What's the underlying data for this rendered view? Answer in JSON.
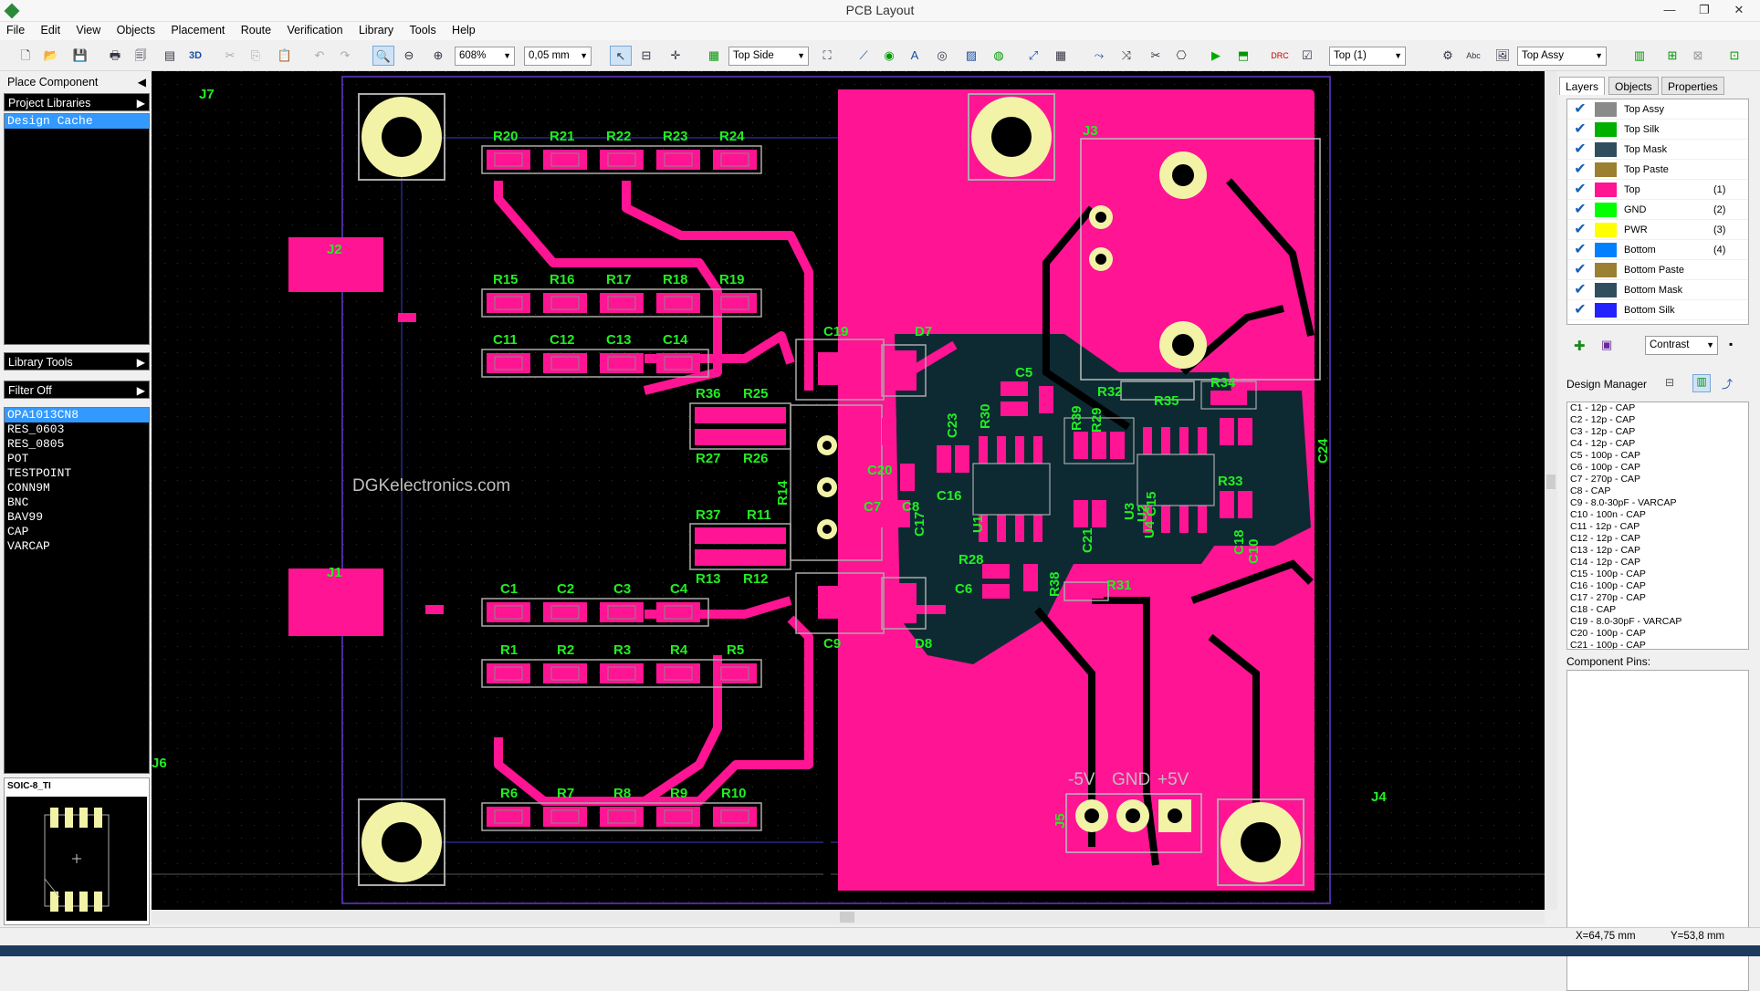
{
  "window": {
    "title": "PCB Layout",
    "minimize": "—",
    "maximize": "❐",
    "close": "✕"
  },
  "menu": [
    "File",
    "Edit",
    "View",
    "Objects",
    "Placement",
    "Route",
    "Verification",
    "Library",
    "Tools",
    "Help"
  ],
  "toolbar": {
    "zoom": "608%",
    "grid": "0,05 mm",
    "side": "Top Side",
    "layer": "Top (1)",
    "assy": "Top Assy"
  },
  "left_panel": {
    "place_component": "Place Component",
    "project_libraries": "Project Libraries",
    "design_cache": "Design Cache",
    "library_tools": "Library Tools",
    "filter_off": "Filter Off",
    "components": [
      "OPA1013CN8",
      "RES_0603",
      "RES_0805",
      "POT",
      "TESTPOINT",
      "CONN9M",
      "BNC",
      "BAV99",
      "CAP",
      "VARCAP"
    ],
    "selected_component": "OPA1013CN8",
    "preview_label": "SOIC-8_TI"
  },
  "canvas": {
    "watermark": "DGKelectronics.com",
    "power_labels": [
      "-5V",
      "GND",
      "+5V"
    ],
    "refdes": {
      "J1": "J1",
      "J2": "J2",
      "J3": "J3",
      "J4": "J4",
      "J5": "J5",
      "J6": "J6",
      "J7": "J7",
      "row1": [
        "R20",
        "R21",
        "R22",
        "R23",
        "R24"
      ],
      "row2": [
        "R15",
        "R16",
        "R17",
        "R18",
        "R19"
      ],
      "row3": [
        "C11",
        "C12",
        "C13",
        "C14"
      ],
      "row4": [
        "C1",
        "C2",
        "C3",
        "C4"
      ],
      "row5": [
        "R1",
        "R2",
        "R3",
        "R4",
        "R5"
      ],
      "row6": [
        "R6",
        "R7",
        "R8",
        "R9",
        "R10"
      ],
      "mid_top": [
        "R36",
        "R25",
        "R27",
        "R26"
      ],
      "mid_bot": [
        "R37",
        "R11",
        "R13",
        "R12"
      ],
      "misc": [
        "C19",
        "D7",
        "C9",
        "D8",
        "R14",
        "C5",
        "R32",
        "R35",
        "R34",
        "R39",
        "R30",
        "C23",
        "C20",
        "C16",
        "C7",
        "C8",
        "C6",
        "R28",
        "R38",
        "R31",
        "R33",
        "U1",
        "U2",
        "C18",
        "C24",
        "C10",
        "C17",
        "R29",
        "C15",
        "C21",
        "U3",
        "U4"
      ]
    }
  },
  "right_panel": {
    "tabs": [
      "Layers",
      "Objects",
      "Properties"
    ],
    "active_tab": "Layers",
    "layers": [
      {
        "name": "Top Assy",
        "color": "#8a8a8a",
        "num": ""
      },
      {
        "name": "Top Silk",
        "color": "#00b000",
        "num": ""
      },
      {
        "name": "Top Mask",
        "color": "#2f4f5f",
        "num": ""
      },
      {
        "name": "Top Paste",
        "color": "#9a8030",
        "num": ""
      },
      {
        "name": "Top",
        "color": "#ff1493",
        "num": "(1)"
      },
      {
        "name": "GND",
        "color": "#00ff00",
        "num": "(2)"
      },
      {
        "name": "PWR",
        "color": "#ffff00",
        "num": "(3)"
      },
      {
        "name": "Bottom",
        "color": "#0080ff",
        "num": "(4)"
      },
      {
        "name": "Bottom Paste",
        "color": "#9a8030",
        "num": ""
      },
      {
        "name": "Bottom Mask",
        "color": "#2f4f5f",
        "num": ""
      },
      {
        "name": "Bottom Silk",
        "color": "#2222ff",
        "num": ""
      }
    ],
    "contrast": "Contrast",
    "design_manager": "Design Manager",
    "dm_items": [
      "C1 - 12p - CAP",
      "C2 - 12p - CAP",
      "C3 - 12p - CAP",
      "C4 - 12p - CAP",
      "C5 - 100p - CAP",
      "C6 - 100p - CAP",
      "C7 - 270p - CAP",
      "C8 - CAP",
      "C9 - 8.0-30pF - VARCAP",
      "C10 - 100n - CAP",
      "C11 - 12p - CAP",
      "C12 - 12p - CAP",
      "C13 - 12p - CAP",
      "C14 - 12p - CAP",
      "C15 - 100p - CAP",
      "C16 - 100p - CAP",
      "C17 - 270p - CAP",
      "C18 - CAP",
      "C19 - 8.0-30pF - VARCAP",
      "C20 - 100p - CAP",
      "C21 - 100p - CAP"
    ],
    "component_pins": "Component Pins:"
  },
  "status": {
    "x": "X=64,75 mm",
    "y": "Y=53,8 mm"
  }
}
